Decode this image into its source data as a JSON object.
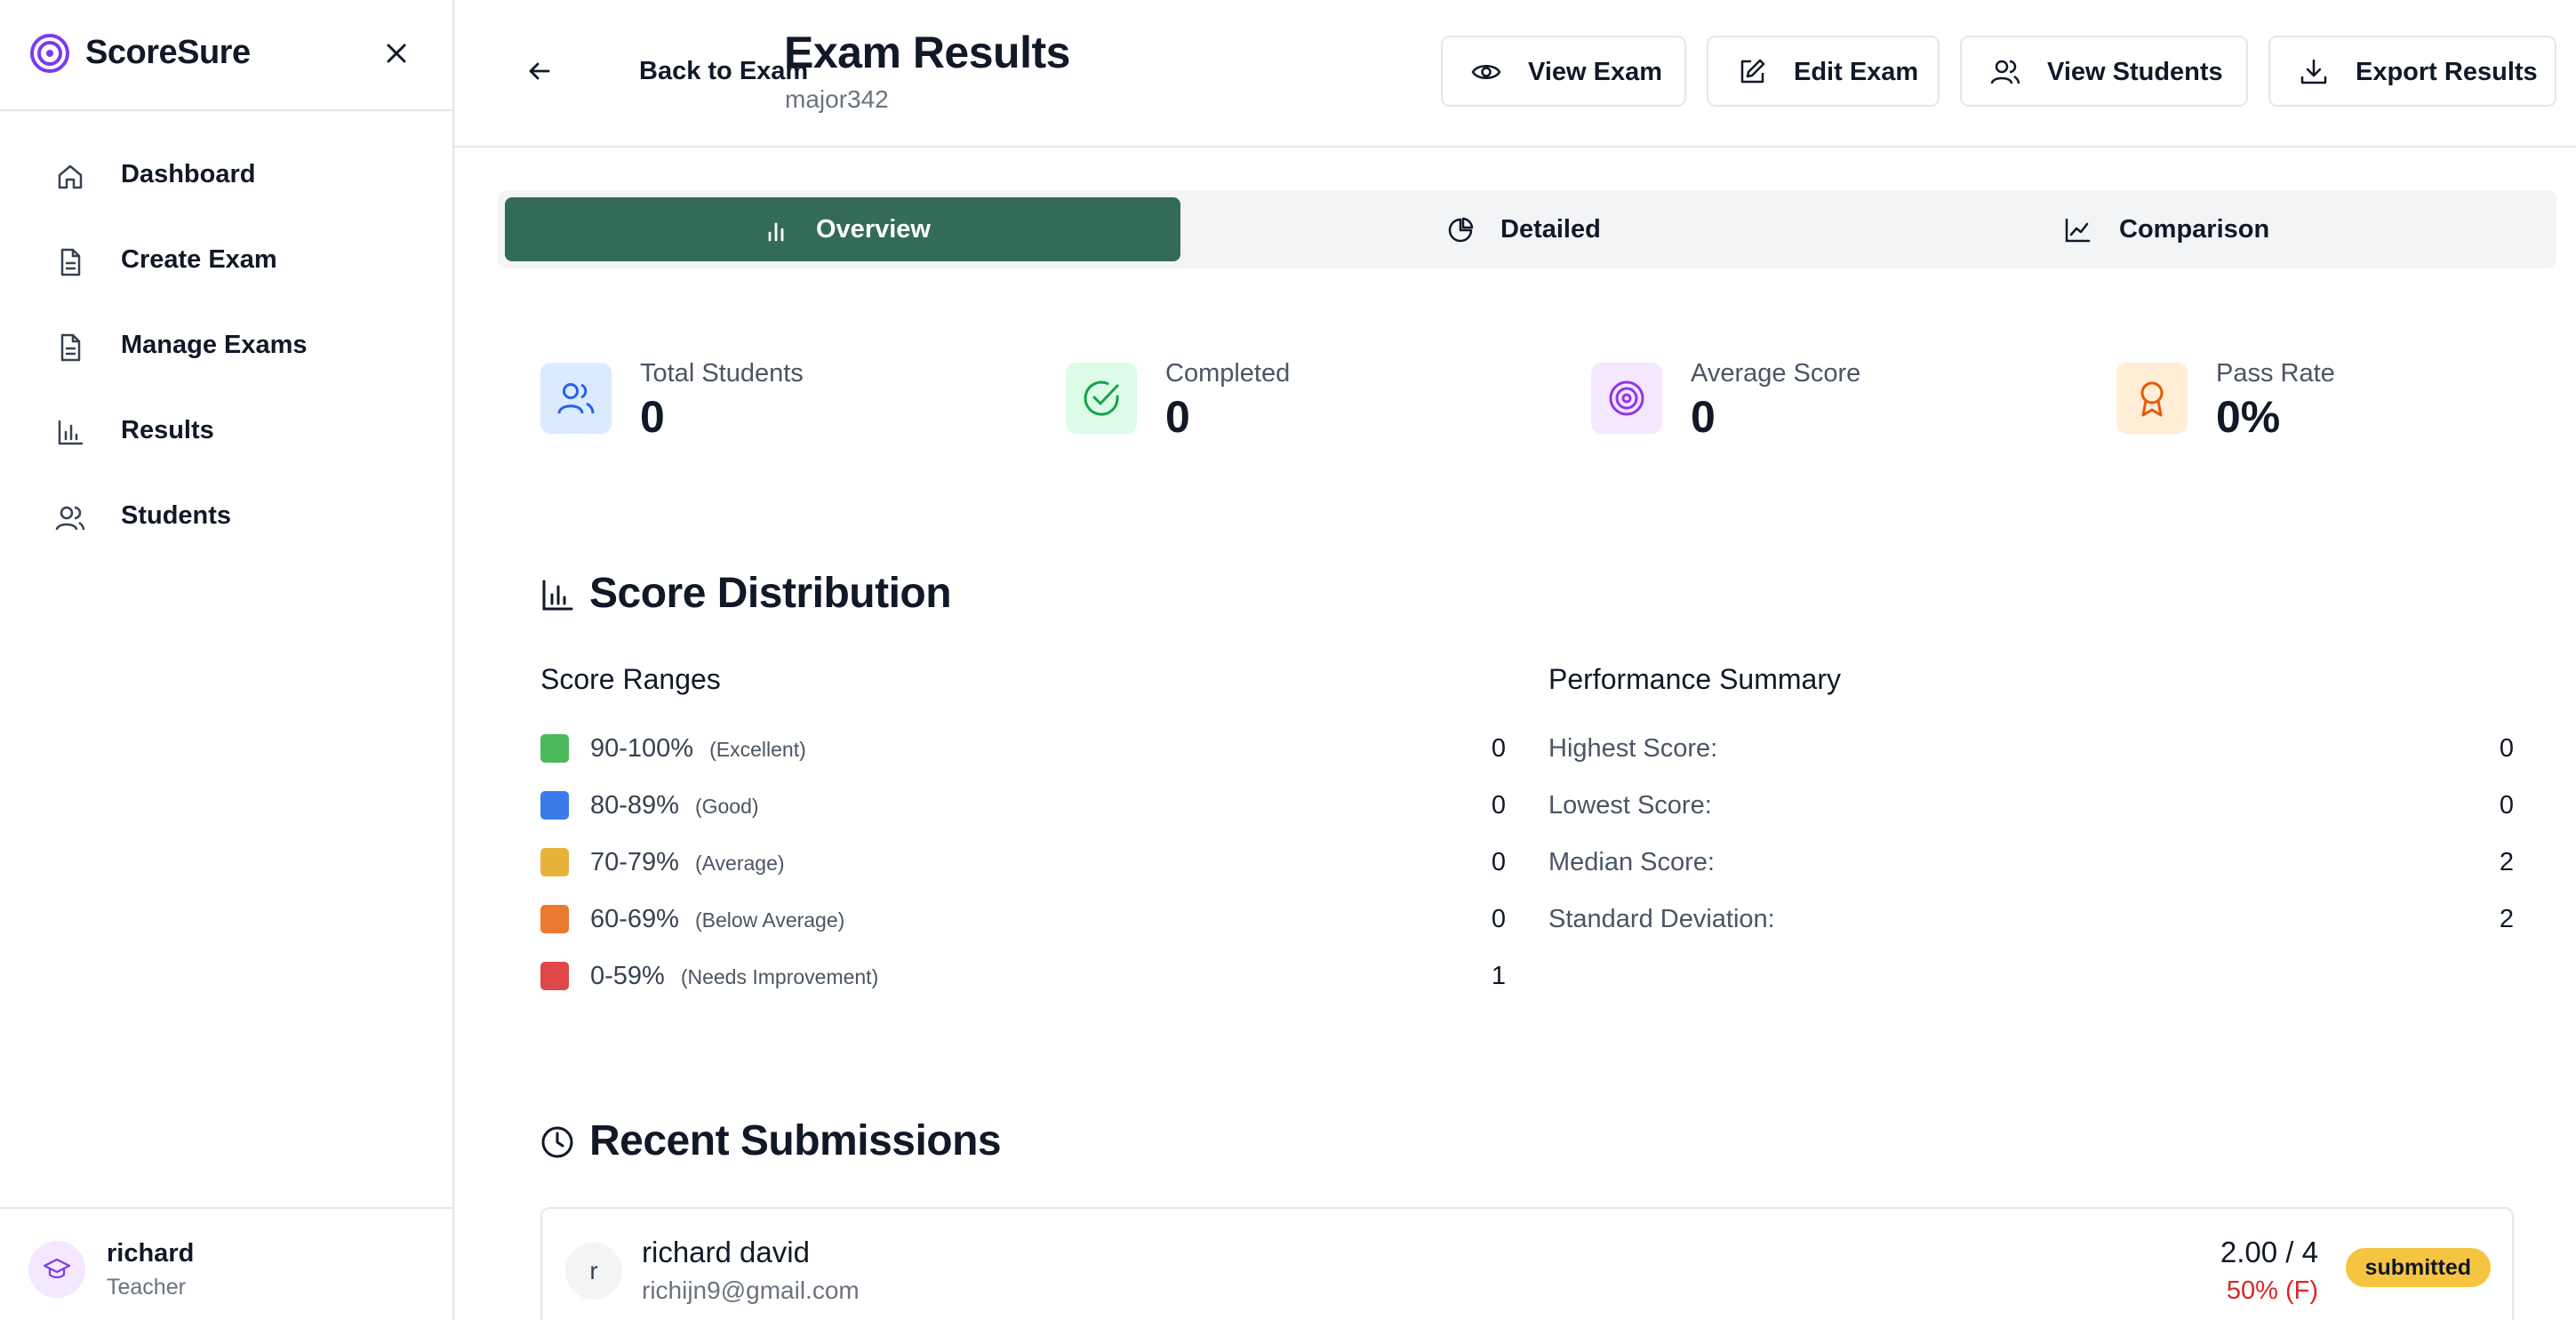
{
  "app": {
    "name": "ScoreSure"
  },
  "sidebar": {
    "items": [
      {
        "label": "Dashboard",
        "icon": "home-icon"
      },
      {
        "label": "Create Exam",
        "icon": "file-icon"
      },
      {
        "label": "Manage Exams",
        "icon": "file-icon"
      },
      {
        "label": "Results",
        "icon": "bar-chart-icon"
      },
      {
        "label": "Students",
        "icon": "users-icon"
      }
    ],
    "user": {
      "name": "richard",
      "role": "Teacher",
      "icon": "graduation-cap-icon"
    }
  },
  "header": {
    "back_label": "Back to Exam",
    "title": "Exam Results",
    "subtitle": "major342",
    "buttons": {
      "view_exam": "View Exam",
      "edit_exam": "Edit Exam",
      "view_students": "View Students",
      "export_results": "Export Results"
    }
  },
  "tabs": {
    "overview": "Overview",
    "detailed": "Detailed",
    "comparison": "Comparison",
    "active": "Overview"
  },
  "stats": {
    "total_students": {
      "label": "Total Students",
      "value": "0"
    },
    "completed": {
      "label": "Completed",
      "value": "0"
    },
    "average_score": {
      "label": "Average Score",
      "value": "0"
    },
    "pass_rate": {
      "label": "Pass Rate",
      "value": "0%"
    }
  },
  "distribution": {
    "title": "Score Distribution",
    "ranges_title": "Score Ranges",
    "ranges": [
      {
        "range": "90-100%",
        "desc": "(Excellent)",
        "count": "0",
        "color": "#4cb85c"
      },
      {
        "range": "80-89%",
        "desc": "(Good)",
        "count": "0",
        "color": "#3b7ae8"
      },
      {
        "range": "70-79%",
        "desc": "(Average)",
        "count": "0",
        "color": "#e8b23a"
      },
      {
        "range": "60-69%",
        "desc": "(Below Average)",
        "count": "0",
        "color": "#ea7a30"
      },
      {
        "range": "0-59%",
        "desc": "(Needs Improvement)",
        "count": "1",
        "color": "#e04848"
      }
    ],
    "summary_title": "Performance Summary",
    "summary": [
      {
        "label": "Highest Score:",
        "value": "0"
      },
      {
        "label": "Lowest Score:",
        "value": "0"
      },
      {
        "label": "Median Score:",
        "value": "2"
      },
      {
        "label": "Standard Deviation:",
        "value": "2"
      }
    ]
  },
  "recent": {
    "title": "Recent Submissions",
    "submissions": [
      {
        "initial": "r",
        "name": "richard david",
        "email": "richijn9@gmail.com",
        "score": "2.00 / 4",
        "percent": "50% (F)",
        "status": "submitted"
      }
    ]
  },
  "colors": {
    "accent": "#346a5a",
    "brand": "#7c3aed",
    "fail": "#dc2626",
    "badge": "#f5c542"
  }
}
